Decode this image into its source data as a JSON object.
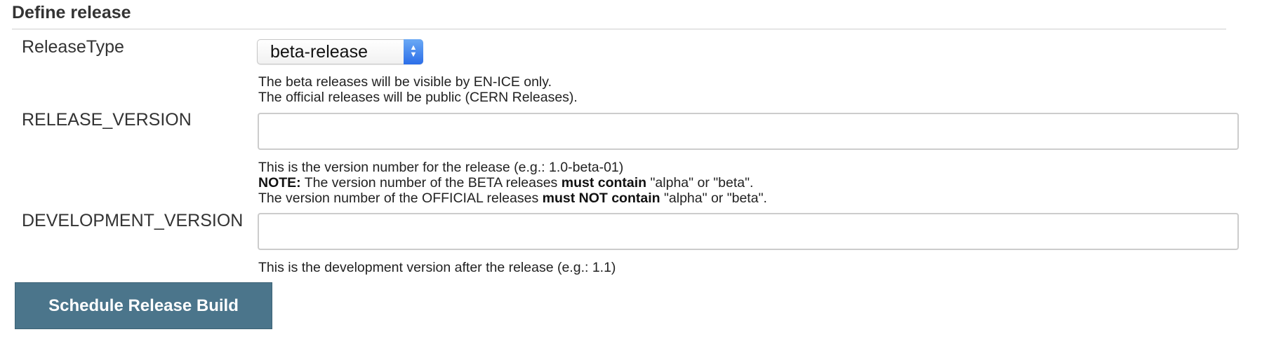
{
  "section": {
    "title": "Define release"
  },
  "release_type": {
    "label": "ReleaseType",
    "selected": "beta-release",
    "help_line1": "The beta releases will be visible by EN-ICE only.",
    "help_line2": "The official releases will be public (CERN Releases)."
  },
  "release_version": {
    "label": "RELEASE_VERSION",
    "value": "",
    "help_line1": "This is the version number for the release (e.g.: 1.0-beta-01)",
    "note_prefix": "NOTE:",
    "note_text1": " The version number of the BETA releases ",
    "note_bold1": "must contain",
    "note_text2": " \"alpha\" or \"beta\".",
    "official_text1": "The version number of the OFFICIAL releases ",
    "official_bold": "must NOT contain",
    "official_text2": " \"alpha\" or \"beta\"."
  },
  "development_version": {
    "label": "DEVELOPMENT_VERSION",
    "value": "",
    "help": "This is the development version after the release (e.g.: 1.1)"
  },
  "submit": {
    "label": "Schedule Release Build",
    "color": "#4b758b"
  }
}
